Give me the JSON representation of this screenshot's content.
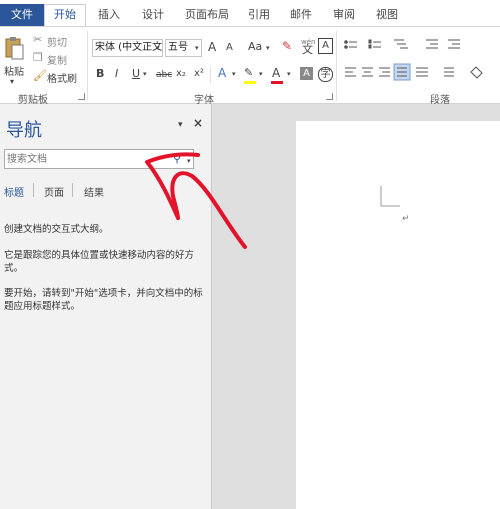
{
  "tabs": {
    "file": "文件",
    "home": "开始",
    "insert": "插入",
    "design": "设计",
    "layout": "页面布局",
    "references": "引用",
    "mailings": "邮件",
    "review": "审阅",
    "view": "视图"
  },
  "clipboard": {
    "paste": "粘贴",
    "cut": "剪切",
    "copy": "复制",
    "format_painter": "格式刷",
    "group_label": "剪贴板"
  },
  "font": {
    "name": "宋体 (中文正文",
    "size": "五号",
    "group_label": "字体",
    "wen_label": "wén",
    "wen_char": "文",
    "bold": "B",
    "italic": "I",
    "underline": "U",
    "strikethrough": "abc",
    "subscript": "x₂",
    "superscript": "x²",
    "grow": "A",
    "shrink": "A",
    "change_case": "Aa",
    "char_border": "A",
    "text_effects": "A",
    "font_color": "A",
    "char_shading": "A"
  },
  "paragraph": {
    "group_label": "段落"
  },
  "nav": {
    "title": "导航",
    "search_placeholder": "搜索文档",
    "tab_headings": "标题",
    "tab_pages": "页面",
    "tab_results": "结果",
    "para1": "创建文档的交互式大纲。",
    "para2": "它是跟踪您的具体位置或快速移动内容的好方式。",
    "para3": "要开始，请转到\"开始\"选项卡，并向文档中的标题应用标题样式。"
  },
  "colors": {
    "accent": "#2b579a",
    "annotation": "#e3132b"
  }
}
